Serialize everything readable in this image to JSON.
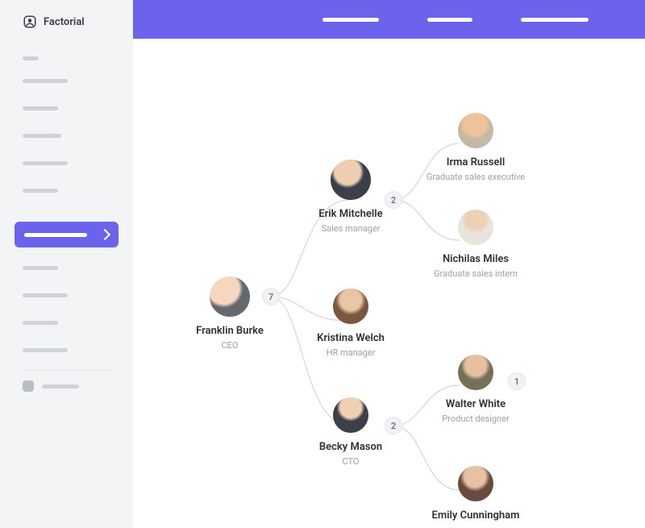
{
  "brand": {
    "name": "Factorial"
  },
  "colors": {
    "accent": "#6b63ec"
  },
  "org": {
    "root": {
      "name": "Franklin Burke",
      "role": "CEO",
      "reports": 7
    },
    "level2": [
      {
        "name": "Erik Mitchelle",
        "role": "Sales manager",
        "reports": 2
      },
      {
        "name": "Kristina Welch",
        "role": "HR manager"
      },
      {
        "name": "Becky Mason",
        "role": "CTO",
        "reports": 2
      }
    ],
    "level3": [
      {
        "parent": 0,
        "name": "Irma Russell",
        "role": "Graduate sales executive"
      },
      {
        "parent": 0,
        "name": "Nichilas Miles",
        "role": "Graduate sales intern"
      },
      {
        "parent": 2,
        "name": "Walter White",
        "role": "Product designer",
        "reports": 1
      },
      {
        "parent": 2,
        "name": "Emily Cunningham",
        "role": ""
      }
    ]
  }
}
